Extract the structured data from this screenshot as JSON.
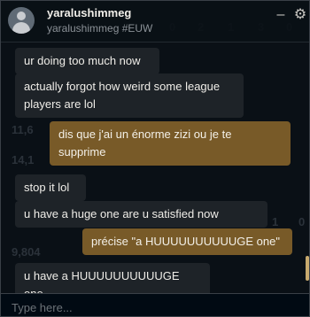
{
  "header": {
    "display_name": "yaralushimmeg",
    "tag": "yaralushimmeg #EUW",
    "minimize_label": "–",
    "settings_label": "⚙"
  },
  "background_stats": [
    "0",
    "2",
    "1",
    "3",
    "0",
    "11,6",
    "14,1",
    "9,804",
    "1",
    "0"
  ],
  "messages": [
    {
      "text": "ur doing too much now",
      "from": "them"
    },
    {
      "text": "actually forgot how weird some league players are lol",
      "from": "them"
    },
    {
      "text": "dis que j'ai un énorme zizi ou je te supprime",
      "from": "me"
    },
    {
      "text": "stop it lol",
      "from": "them"
    },
    {
      "text": "u have a huge one are u satisfied now",
      "from": "them"
    },
    {
      "text": "précise \"a HUUUUUUUUUUGE one\"",
      "from": "me"
    },
    {
      "text": "u have a HUUUUUUUUUUGE one",
      "from": "them"
    }
  ],
  "composer": {
    "placeholder": "Type here..."
  },
  "colors": {
    "received_bubble": "#1e2328",
    "sent_bubble": "#785a28",
    "accent": "#c8aa6e"
  }
}
